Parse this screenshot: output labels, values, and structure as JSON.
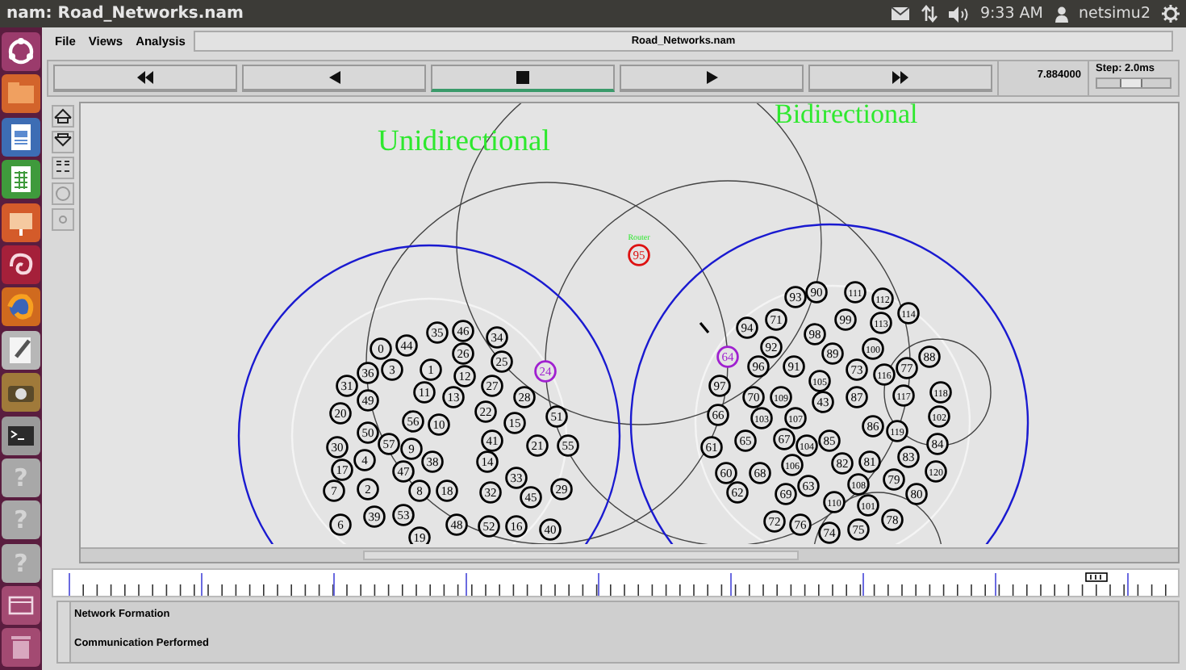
{
  "window": {
    "title": "nam: Road_Networks.nam"
  },
  "top_panel": {
    "time": "9:33 AM",
    "user": "netsimu2"
  },
  "launcher": [
    {
      "kind": "ubuntu"
    },
    {
      "kind": "files"
    },
    {
      "kind": "writer"
    },
    {
      "kind": "calc"
    },
    {
      "kind": "impress"
    },
    {
      "kind": "swirl"
    },
    {
      "kind": "browser"
    },
    {
      "kind": "editor"
    },
    {
      "kind": "camera"
    },
    {
      "kind": "terminal"
    },
    {
      "kind": "unknown",
      "glyph": "?"
    },
    {
      "kind": "unknown",
      "glyph": "?"
    },
    {
      "kind": "unknown",
      "glyph": "?"
    },
    {
      "kind": "window"
    },
    {
      "kind": "trash"
    }
  ],
  "menu": [
    "File",
    "Views",
    "Analysis"
  ],
  "file_title": "Road_Networks.nam",
  "playback": [
    {
      "kind": "rewind",
      "selected": false
    },
    {
      "kind": "back",
      "selected": false
    },
    {
      "kind": "stop",
      "selected": true
    },
    {
      "kind": "play",
      "selected": false
    },
    {
      "kind": "forward",
      "selected": false
    }
  ],
  "sim_time": "7.884000",
  "step": {
    "label": "Step: 2.0ms",
    "level": 0.45
  },
  "canvas": {
    "labels": [
      "Unidirectional",
      "Bidirectional"
    ],
    "nodes": [
      {
        "number": "95",
        "color": "#dd1111",
        "label": "Router"
      },
      {
        "number": "24",
        "color": "#a020d0"
      },
      {
        "number": "64",
        "color": "#a020d0"
      },
      {
        "number": "35",
        "color": "#000000"
      },
      {
        "number": "46",
        "color": "#000000"
      },
      {
        "number": "34",
        "color": "#000000"
      },
      {
        "number": "0",
        "color": "#000000"
      },
      {
        "number": "44",
        "color": "#000000"
      },
      {
        "number": "26",
        "color": "#000000"
      },
      {
        "number": "25",
        "color": "#000000"
      },
      {
        "number": "36",
        "color": "#000000"
      },
      {
        "number": "3",
        "color": "#000000"
      },
      {
        "number": "1",
        "color": "#000000"
      },
      {
        "number": "12",
        "color": "#000000"
      },
      {
        "number": "31",
        "color": "#000000"
      },
      {
        "number": "27",
        "color": "#000000"
      },
      {
        "number": "49",
        "color": "#000000"
      },
      {
        "number": "11",
        "color": "#000000"
      },
      {
        "number": "13",
        "color": "#000000"
      },
      {
        "number": "28",
        "color": "#000000"
      },
      {
        "number": "20",
        "color": "#000000"
      },
      {
        "number": "22",
        "color": "#000000"
      },
      {
        "number": "15",
        "color": "#000000"
      },
      {
        "number": "51",
        "color": "#000000"
      },
      {
        "number": "56",
        "color": "#000000"
      },
      {
        "number": "10",
        "color": "#000000"
      },
      {
        "number": "50",
        "color": "#000000"
      },
      {
        "number": "30",
        "color": "#000000"
      },
      {
        "number": "57",
        "color": "#000000"
      },
      {
        "number": "9",
        "color": "#000000"
      },
      {
        "number": "41",
        "color": "#000000"
      },
      {
        "number": "21",
        "color": "#000000"
      },
      {
        "number": "55",
        "color": "#000000"
      },
      {
        "number": "4",
        "color": "#000000"
      },
      {
        "number": "38",
        "color": "#000000"
      },
      {
        "number": "14",
        "color": "#000000"
      },
      {
        "number": "17",
        "color": "#000000"
      },
      {
        "number": "47",
        "color": "#000000"
      },
      {
        "number": "33",
        "color": "#000000"
      },
      {
        "number": "7",
        "color": "#000000"
      },
      {
        "number": "2",
        "color": "#000000"
      },
      {
        "number": "8",
        "color": "#000000"
      },
      {
        "number": "18",
        "color": "#000000"
      },
      {
        "number": "32",
        "color": "#000000"
      },
      {
        "number": "45",
        "color": "#000000"
      },
      {
        "number": "29",
        "color": "#000000"
      },
      {
        "number": "6",
        "color": "#000000"
      },
      {
        "number": "39",
        "color": "#000000"
      },
      {
        "number": "53",
        "color": "#000000"
      },
      {
        "number": "48",
        "color": "#000000"
      },
      {
        "number": "52",
        "color": "#000000"
      },
      {
        "number": "16",
        "color": "#000000"
      },
      {
        "number": "40",
        "color": "#000000"
      },
      {
        "number": "19",
        "color": "#000000"
      },
      {
        "number": "93",
        "color": "#000000"
      },
      {
        "number": "90",
        "color": "#000000"
      },
      {
        "number": "111",
        "color": "#000000"
      },
      {
        "number": "112",
        "color": "#000000"
      },
      {
        "number": "94",
        "color": "#000000"
      },
      {
        "number": "71",
        "color": "#000000"
      },
      {
        "number": "99",
        "color": "#000000"
      },
      {
        "number": "113",
        "color": "#000000"
      },
      {
        "number": "114",
        "color": "#000000"
      },
      {
        "number": "98",
        "color": "#000000"
      },
      {
        "number": "92",
        "color": "#000000"
      },
      {
        "number": "89",
        "color": "#000000"
      },
      {
        "number": "100",
        "color": "#000000"
      },
      {
        "number": "88",
        "color": "#000000"
      },
      {
        "number": "96",
        "color": "#000000"
      },
      {
        "number": "91",
        "color": "#000000"
      },
      {
        "number": "73",
        "color": "#000000"
      },
      {
        "number": "116",
        "color": "#000000"
      },
      {
        "number": "77",
        "color": "#000000"
      },
      {
        "number": "97",
        "color": "#000000"
      },
      {
        "number": "105",
        "color": "#000000"
      },
      {
        "number": "70",
        "color": "#000000"
      },
      {
        "number": "109",
        "color": "#000000"
      },
      {
        "number": "43",
        "color": "#000000"
      },
      {
        "number": "87",
        "color": "#000000"
      },
      {
        "number": "117",
        "color": "#000000"
      },
      {
        "number": "118",
        "color": "#000000"
      },
      {
        "number": "66",
        "color": "#000000"
      },
      {
        "number": "103",
        "color": "#000000"
      },
      {
        "number": "107",
        "color": "#000000"
      },
      {
        "number": "86",
        "color": "#000000"
      },
      {
        "number": "119",
        "color": "#000000"
      },
      {
        "number": "102",
        "color": "#000000"
      },
      {
        "number": "61",
        "color": "#000000"
      },
      {
        "number": "65",
        "color": "#000000"
      },
      {
        "number": "67",
        "color": "#000000"
      },
      {
        "number": "104",
        "color": "#000000"
      },
      {
        "number": "85",
        "color": "#000000"
      },
      {
        "number": "84",
        "color": "#000000"
      },
      {
        "number": "60",
        "color": "#000000"
      },
      {
        "number": "68",
        "color": "#000000"
      },
      {
        "number": "106",
        "color": "#000000"
      },
      {
        "number": "82",
        "color": "#000000"
      },
      {
        "number": "81",
        "color": "#000000"
      },
      {
        "number": "83",
        "color": "#000000"
      },
      {
        "number": "120",
        "color": "#000000"
      },
      {
        "number": "108",
        "color": "#000000"
      },
      {
        "number": "79",
        "color": "#000000"
      },
      {
        "number": "63",
        "color": "#000000"
      },
      {
        "number": "62",
        "color": "#000000"
      },
      {
        "number": "69",
        "color": "#000000"
      },
      {
        "number": "80",
        "color": "#000000"
      },
      {
        "number": "110",
        "color": "#000000"
      },
      {
        "number": "101",
        "color": "#000000"
      },
      {
        "number": "72",
        "color": "#000000"
      },
      {
        "number": "76",
        "color": "#000000"
      },
      {
        "number": "78",
        "color": "#000000"
      },
      {
        "number": "74",
        "color": "#000000"
      },
      {
        "number": "75",
        "color": "#000000"
      }
    ]
  },
  "annotations": [
    "Network Formation",
    "Communication Performed"
  ]
}
